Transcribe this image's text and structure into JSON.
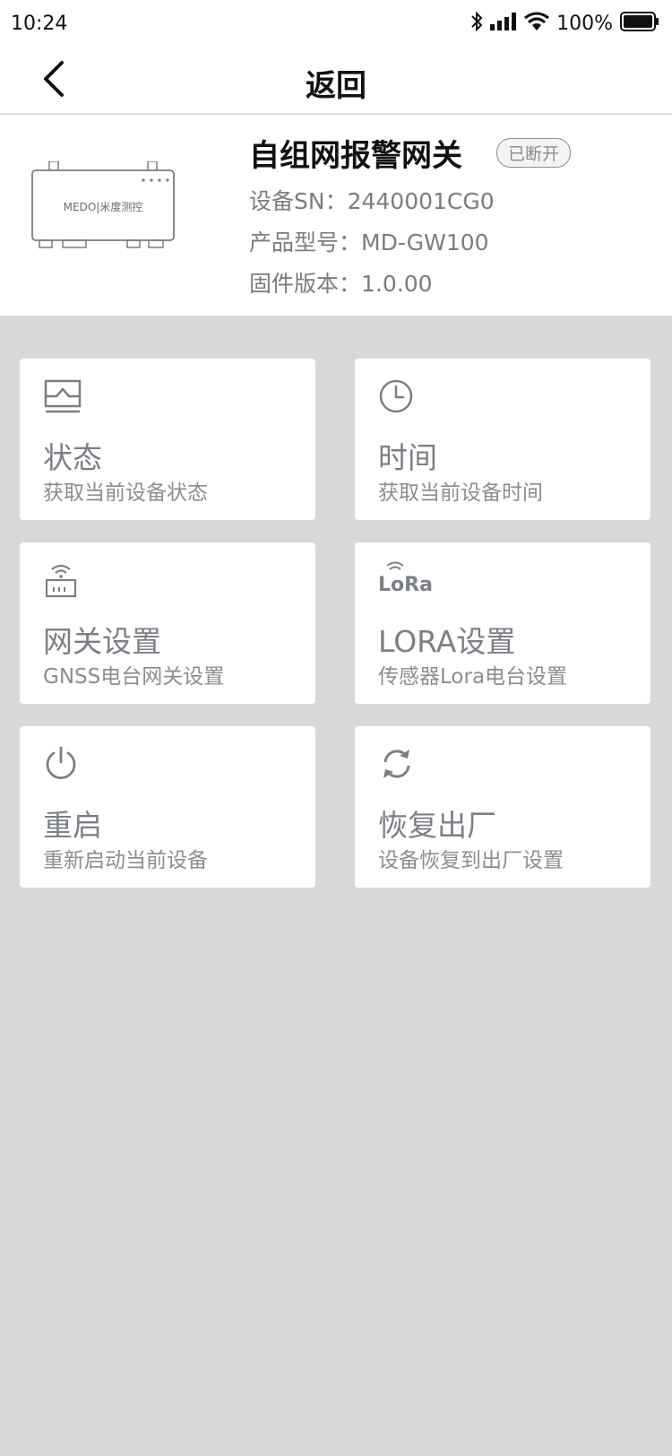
{
  "status_bar": {
    "time": "10:24",
    "battery_text": "100%",
    "icons": [
      "bluetooth-icon",
      "signal-icon",
      "wifi-icon",
      "battery-icon"
    ]
  },
  "nav": {
    "title": "返回",
    "back_icon": "chevron-left-icon"
  },
  "device": {
    "name": "自组网报警网关",
    "status": "已断开",
    "sn": "设备SN：2440001CG0",
    "model": "产品型号：MD-GW100",
    "firmware": "固件版本：1.0.00",
    "image_brand": "MEDO|米度测控"
  },
  "cards": [
    {
      "icon": "monitor-icon",
      "title": "状态",
      "subtitle": "获取当前设备状态"
    },
    {
      "icon": "clock-icon",
      "title": "时间",
      "subtitle": "获取当前设备时间"
    },
    {
      "icon": "router-icon",
      "title": "网关设置",
      "subtitle": "GNSS电台网关设置"
    },
    {
      "icon": "lora-icon",
      "title": "LORA设置",
      "subtitle": "传感器Lora电台设置",
      "icon_text": "LoRa"
    },
    {
      "icon": "power-icon",
      "title": "重启",
      "subtitle": "重新启动当前设备"
    },
    {
      "icon": "refresh-icon",
      "title": "恢复出厂",
      "subtitle": "设备恢复到出厂设置"
    }
  ],
  "colors": {
    "page_background": "#d8d8d8",
    "card_background": "#ffffff",
    "card_text": "#7b7f86",
    "badge_border": "#8d8d8d"
  }
}
